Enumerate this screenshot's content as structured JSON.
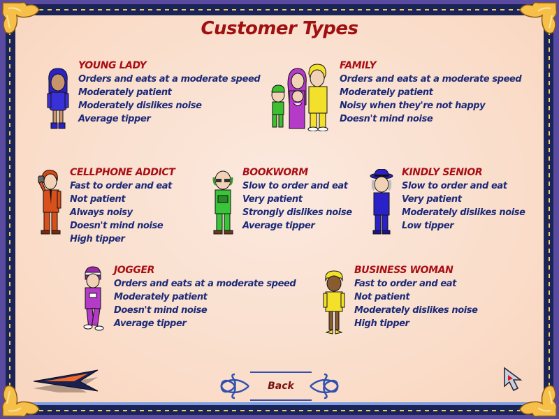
{
  "page": {
    "title": "Customer Types"
  },
  "customers": [
    {
      "name": "YOUNG LADY",
      "portrait_icon": "young-lady-portrait",
      "traits": [
        "Orders and eats at a moderate speed",
        "Moderately patient",
        "Moderately dislikes noise",
        "Average tipper"
      ]
    },
    {
      "name": "FAMILY",
      "portrait_icon": "family-portrait",
      "traits": [
        "Orders and eats at a moderate speed",
        "Moderately patient",
        "Noisy when they're not happy",
        "Doesn't mind noise"
      ]
    },
    {
      "name": "CELLPHONE ADDICT",
      "portrait_icon": "cellphone-addict-portrait",
      "traits": [
        "Fast to order and eat",
        "Not patient",
        "Always noisy",
        "Doesn't mind noise",
        "High tipper"
      ]
    },
    {
      "name": "BOOKWORM",
      "portrait_icon": "bookworm-portrait",
      "traits": [
        "Slow to order and eat",
        "Very patient",
        "Strongly dislikes noise",
        "Average tipper"
      ]
    },
    {
      "name": "KINDLY SENIOR",
      "portrait_icon": "kindly-senior-portrait",
      "traits": [
        "Slow to order and eat",
        "Very patient",
        "Moderately dislikes noise",
        "Low tipper"
      ]
    },
    {
      "name": "JOGGER",
      "portrait_icon": "jogger-portrait",
      "traits": [
        "Orders and eats at a moderate speed",
        "Moderately patient",
        "Doesn't mind noise",
        "Average tipper"
      ]
    },
    {
      "name": "BUSINESS WOMAN",
      "portrait_icon": "business-woman-portrait",
      "traits": [
        "Fast to order and eat",
        "Not patient",
        "Moderately dislikes noise",
        "High tipper"
      ]
    }
  ],
  "navigation": {
    "back_label": "Back",
    "prev_arrow_icon": "left-arrow-icon",
    "cursor_icon": "mouse-pointer-icon"
  },
  "colors": {
    "title": "#a01010",
    "customer_name": "#a80e14",
    "trait_text": "#1c2a78",
    "frame_blue": "#1a2458",
    "panel_bg": "#fadcc8",
    "corner_gold": "#f6bf4a"
  }
}
